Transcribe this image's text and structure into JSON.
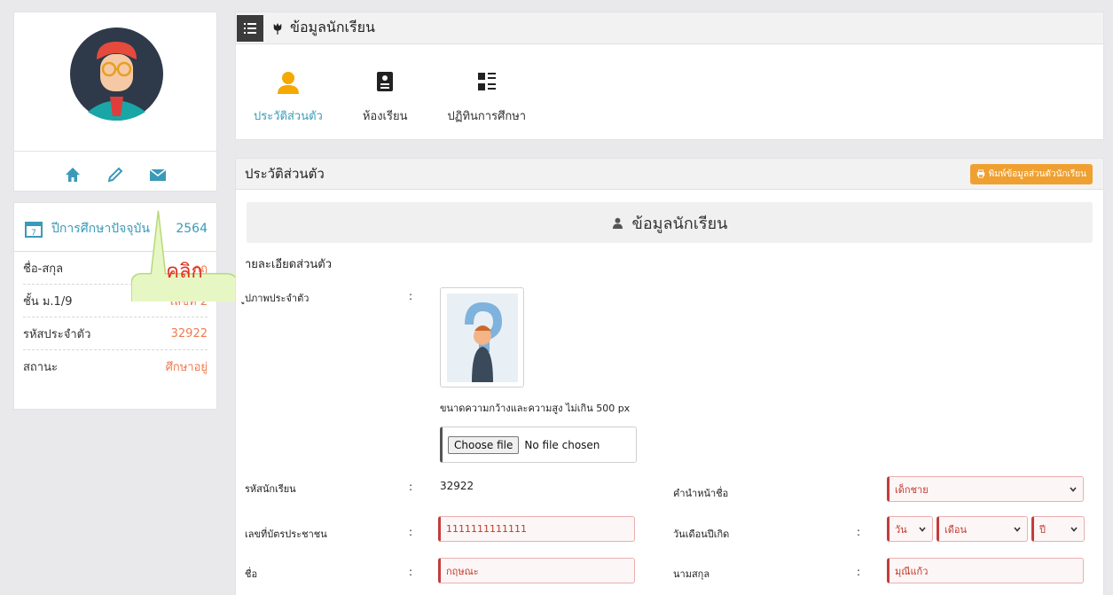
{
  "profile": {
    "avatar_icon": "teacher-avatar-icon",
    "actions": [
      "home-icon",
      "pencil-icon",
      "envelope-icon"
    ]
  },
  "year_card": {
    "label": "ปีการศึกษาปัจจุบัน",
    "year": "2564",
    "rows": [
      {
        "label": "ชื่อ-สกุล",
        "value": "กฤ"
      },
      {
        "label": "ชั้น ม.1/9",
        "value": "เลขที่ 2"
      },
      {
        "label": "รหัสประจำตัว",
        "value": "32922"
      },
      {
        "label": "สถานะ",
        "value": "ศึกษาอยู่"
      }
    ]
  },
  "callout": {
    "text": "คลิก"
  },
  "top_panel": {
    "title": "ข้อมูลนักเรียน",
    "tabs": [
      {
        "label": "ประวัติส่วนตัว",
        "active": true
      },
      {
        "label": "ห้องเรียน",
        "active": false
      },
      {
        "label": "ปฏิทินการศึกษา",
        "active": false
      }
    ]
  },
  "main_panel": {
    "title": "ประวัติส่วนตัว",
    "print_label": "พิมพ์ข้อมูลส่วนตัวนักเรียน",
    "section_title": "ข้อมูลนักเรียน",
    "sub_title": "ายละเอียดส่วนตัว",
    "photo_label": "ูปภาพประจำตัว",
    "photo_hint": "ขนาดความกว้างและความสูง ไม่เกิน 500 px",
    "file_button": "Choose file",
    "file_status": "No file chosen",
    "fields": {
      "student_id_label": "รหัสนักเรียน",
      "student_id_value": "32922",
      "prefix_label": "คำนำหน้าชื่อ",
      "prefix_value": "เด็กชาย",
      "national_id_label": "เลขที่บัตรประชาชน",
      "national_id_value": "1111111111111",
      "birthdate_label": "วันเดือนปีเกิด",
      "birth_day": "วัน",
      "birth_month": "เดือน",
      "birth_year": "ปี",
      "firstname_label": "ชื่อ",
      "firstname_value": "กฤษณะ",
      "lastname_label": "นามสกุล",
      "lastname_value": "มุณีแก้ว",
      "colon": ":"
    }
  },
  "colors": {
    "accent": "#3a9ab8",
    "orange": "#ef7b50",
    "print": "#f0a030",
    "required": "#c43c3c"
  }
}
